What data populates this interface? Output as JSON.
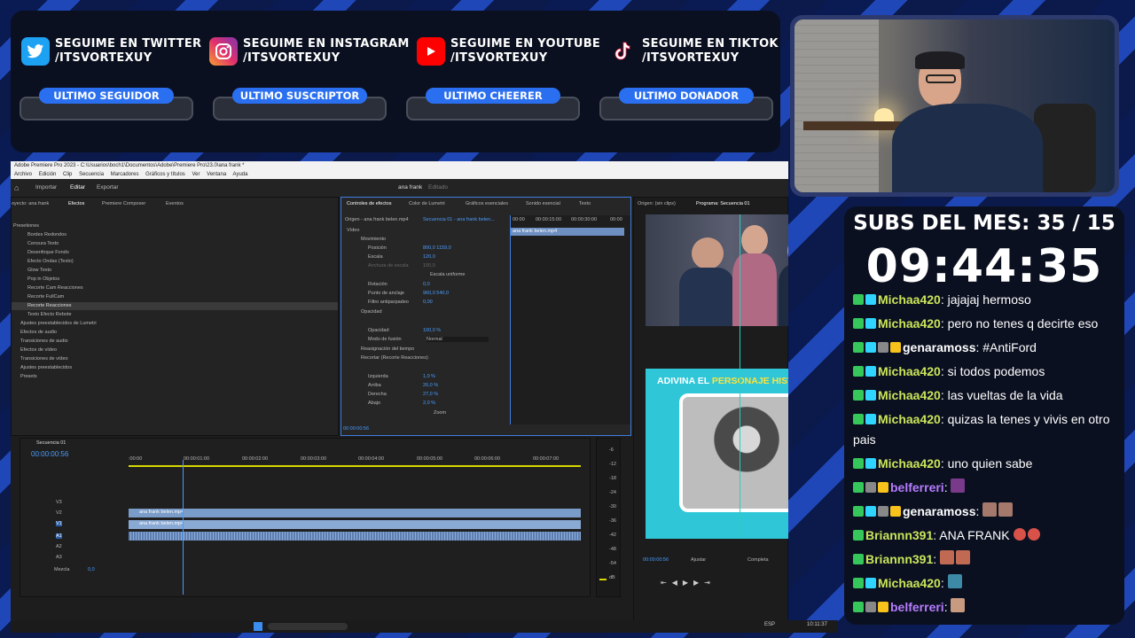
{
  "socials": [
    {
      "network": "twitter",
      "icon": "twitter-bird-icon",
      "color": "#1da1f2",
      "line1": "SEGUIME EN TWITTER",
      "line2": "/ITSVORTEXUY"
    },
    {
      "network": "instagram",
      "icon": "instagram-icon",
      "color": "#e1306c",
      "line1": "SEGUIME EN INSTAGRAM",
      "line2": "/ITSVORTEXUY"
    },
    {
      "network": "youtube",
      "icon": "youtube-play-icon",
      "color": "#ff0000",
      "line1": "SEGUIME EN YOUTUBE",
      "line2": "/ITSVORTEXUY"
    },
    {
      "network": "tiktok",
      "icon": "tiktok-note-icon",
      "color": "#ffffff",
      "line1": "SEGUIME EN TIKTOK",
      "line2": "/ITSVORTEXUY"
    }
  ],
  "widgets": [
    "ULTIMO SEGUIDOR",
    "ULTIMO SUSCRIPTOR",
    "ULTIMO CHEERER",
    "ULTIMO DONADOR"
  ],
  "subs_goal": "SUBS DEL MES: 35 / 15",
  "timer": "09:44:35",
  "chat": [
    {
      "user": "Michaa420",
      "color": "#c9e65a",
      "text": ": jajajaj hermoso"
    },
    {
      "user": "Michaa420",
      "color": "#c9e65a",
      "text": ": pero no tenes q decirte eso"
    },
    {
      "user": "genaramoss",
      "color": "#ffffff",
      "text": ": #AntiFord"
    },
    {
      "user": "Michaa420",
      "color": "#c9e65a",
      "text": ": si todos podemos"
    },
    {
      "user": "Michaa420",
      "color": "#c9e65a",
      "text": ": las vueltas de la vida"
    },
    {
      "user": "Michaa420",
      "color": "#c9e65a",
      "text": ": quizas la tenes y vivis en otro pais"
    },
    {
      "user": "Michaa420",
      "color": "#c9e65a",
      "text": ": uno quien sabe"
    },
    {
      "user": "belferreri",
      "color": "#b57cff",
      "text": ":"
    },
    {
      "user": "genaramoss",
      "color": "#ffffff",
      "text": ":"
    },
    {
      "user": "Briannn391",
      "color": "#c9e65a",
      "text": ": ANA FRANK"
    },
    {
      "user": "Briannn391",
      "color": "#c9e65a",
      "text": ":"
    },
    {
      "user": "Michaa420",
      "color": "#c9e65a",
      "text": ":"
    },
    {
      "user": "belferreri",
      "color": "#b57cff",
      "text": ":"
    }
  ],
  "premiere": {
    "title": "Adobe Premiere Pro 2023 - C:\\Usuarios\\boch1\\Documentos\\Adobe\\Premiere Pro\\23.0\\ana frank *",
    "menus": [
      "Archivo",
      "Edición",
      "Clip",
      "Secuencia",
      "Marcadores",
      "Gráficos y títulos",
      "Ver",
      "Ventana",
      "Ayuda"
    ],
    "workspaces": [
      "Inicio",
      "Importar",
      "Editar",
      "Exportar"
    ],
    "project_name": "ana frank",
    "edited": "Editado",
    "left_tabs": [
      "oyecto: ana frank",
      "Efectos",
      "Premiere Composer",
      "Eventos"
    ],
    "presets": [
      "Presetiones",
      "Bordes Redondos",
      "Censura Texto",
      "Desenfoque Fondo",
      "Efecto Ondas (Texto)",
      "Glow Texto",
      "Pop in Objetos",
      "Recorte Cam Reacciones",
      "Recorte FullCam",
      "Recorte Reacciones",
      "Texto Efecto Rebote",
      "Ajustes preestablecidos de Lumetri",
      "Efectos de audio",
      "Transiciones de audio",
      "Efectos de vídeo",
      "Transiciones de vídeo",
      "Ajustes preestablecidos",
      "Presets"
    ],
    "effect_tabs": [
      "Controles de efectos",
      "Color de Lumetri",
      "Gráficos esenciales",
      "Sonido esencial",
      "Texto"
    ],
    "source": "Origen - ana frank belen.mp4",
    "sequence": "Secuencia 01 - ana frank belen...",
    "video_label": "Vídeo",
    "params": [
      {
        "name": "Movimiento",
        "v": ""
      },
      {
        "name": "Posición",
        "v": "800,0   1159,0"
      },
      {
        "name": "Escala",
        "v": "120,0"
      },
      {
        "name": "Anchura de escala",
        "v": "100,0"
      },
      {
        "name": "",
        "v": "Escala uniforme"
      },
      {
        "name": "Rotación",
        "v": "0,0"
      },
      {
        "name": "Punto de anclaje",
        "v": "960,0   540,0"
      },
      {
        "name": "Filtro antiparpadeo",
        "v": "0,00"
      },
      {
        "name": "Opacidad",
        "v": ""
      },
      {
        "name": "Opacidad",
        "v": "100,0 %"
      },
      {
        "name": "Modo de fusión",
        "v": "Normal"
      },
      {
        "name": "Reasignación del tiempo",
        "v": ""
      },
      {
        "name": "Recortar (Recorte Reacciones)",
        "v": ""
      },
      {
        "name": "Izquierda",
        "v": "1,0 %"
      },
      {
        "name": "Arriba",
        "v": "26,0 %"
      },
      {
        "name": "Derecha",
        "v": "27,0 %"
      },
      {
        "name": "Abajo",
        "v": "2,0 %"
      },
      {
        "name": "",
        "v": "Zoom"
      }
    ],
    "mini_times": [
      "00:00",
      "00:00:15:00",
      "00:00:30:00",
      "00:00"
    ],
    "mini_clip": "ana frank belen.mp4",
    "ec_time": "00:00:00:56",
    "monitor_tabs": [
      "Origen: (sin clips)",
      "Programa: Secuencia 01"
    ],
    "timeline_tab": "Secuencia 01",
    "timecode": "00:00:00:56",
    "ruler": [
      ":00:00",
      "00:00:01:00",
      "00:00:02:00",
      "00:00:03:00",
      "00:00:04:00",
      "00:00:05:00",
      "00:00:06:00",
      "00:00:07:00"
    ],
    "tracks": [
      "V3",
      "V2",
      "V1",
      "A1",
      "A2",
      "A3"
    ],
    "mix_label": "Mezcla",
    "mix_value": "0,0",
    "clip_label": "ana frank belen.mp4",
    "meter": [
      "-6",
      "-12",
      "-18",
      "-24",
      "-30",
      "-36",
      "-42",
      "-48",
      "-54",
      "dB"
    ],
    "program_time": "00:00:00:56",
    "fit": "Ajustar",
    "quality": "Completa",
    "duration": "00:00:45:40",
    "overlay_prefix": "ADIVINA EL",
    "overlay_highlight": "PERSONAJE HISTÓRICO",
    "clock": "10:11:37",
    "lang": "ESP"
  }
}
